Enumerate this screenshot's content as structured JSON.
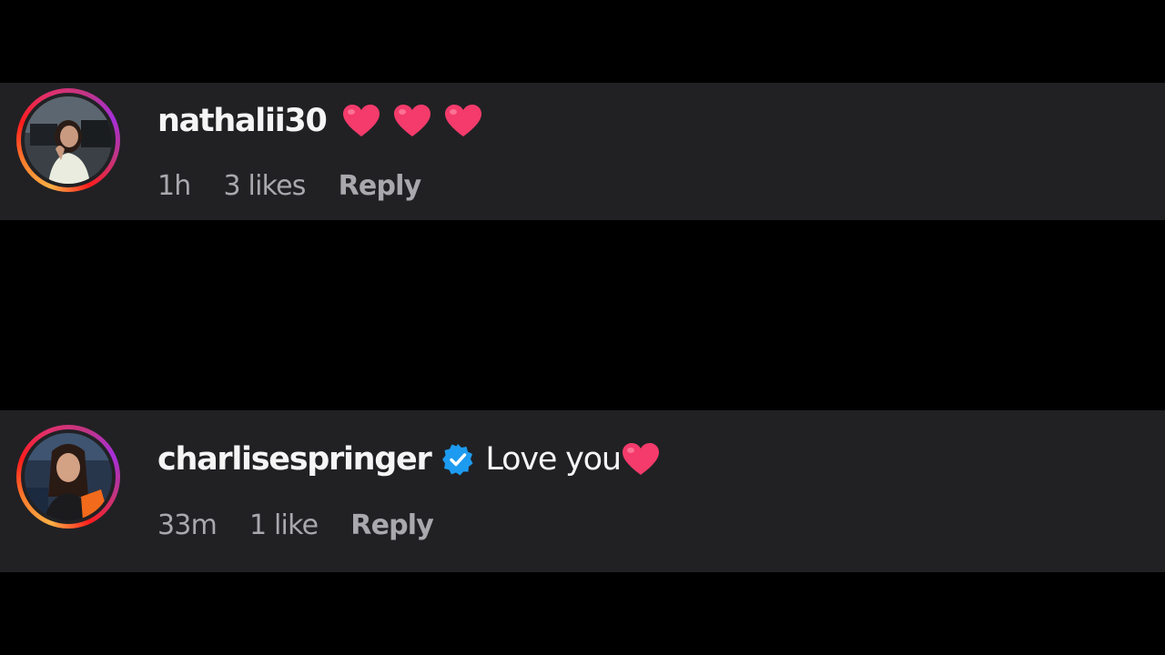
{
  "colors": {
    "background": "#000000",
    "comment_background": "#212124",
    "text_primary": "#f5f5f5",
    "text_secondary": "#a8a8ad",
    "heart": "#f43b6b",
    "verified_badge": "#1d9bf0"
  },
  "comments": [
    {
      "username": "nathalii30",
      "verified": false,
      "text": "",
      "emojis": [
        "red-heart",
        "red-heart",
        "red-heart"
      ],
      "time": "1h",
      "likes": "3 likes",
      "reply_label": "Reply"
    },
    {
      "username": "charlisespringer",
      "verified": true,
      "text": "Love you",
      "emojis": [
        "red-heart"
      ],
      "time": "33m",
      "likes": "1 like",
      "reply_label": "Reply"
    }
  ]
}
